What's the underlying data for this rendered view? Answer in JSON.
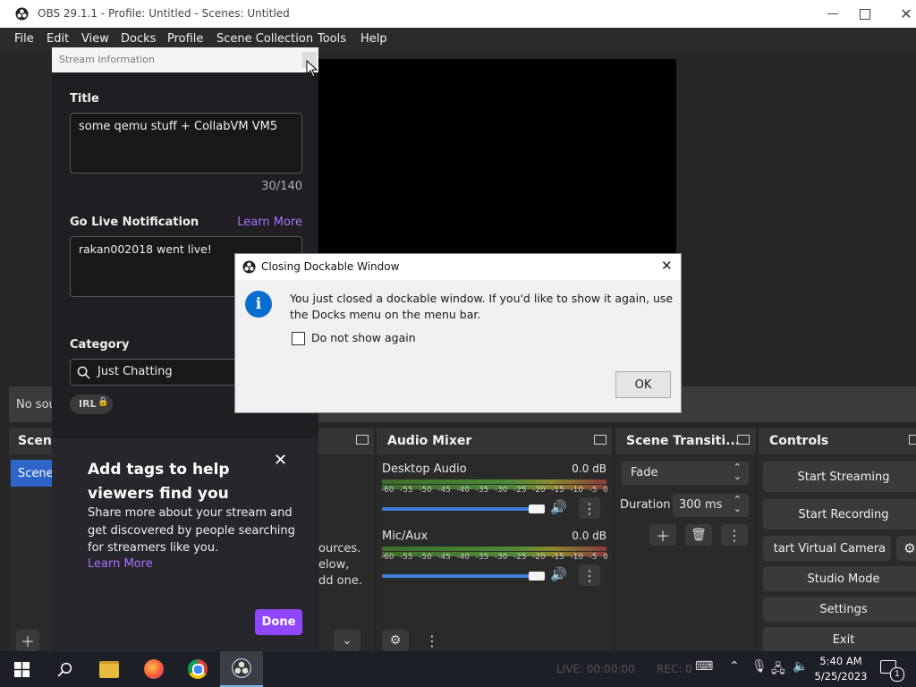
{
  "window": {
    "title": "OBS 29.1.1 - Profile: Untitled - Scenes: Untitled",
    "minimize_icon": "minimize-icon",
    "maximize_icon": "maximize-icon",
    "close_icon": "close-icon"
  },
  "menubar": {
    "items": [
      "File",
      "Edit",
      "View",
      "Docks",
      "Profile",
      "Scene Collection",
      "Tools",
      "Help"
    ]
  },
  "sources_placeholder": "No sou",
  "scenes_dock": {
    "title": "Scene",
    "selected_scene": "Scene"
  },
  "sources_dock": {
    "hint_lines": [
      "ources.",
      "elow,",
      "dd one."
    ]
  },
  "audio_mixer": {
    "title": "Audio Mixer",
    "channels": [
      {
        "name": "Desktop Audio",
        "level": "0.0 dB",
        "volume_fraction": 0.96
      },
      {
        "name": "Mic/Aux",
        "level": "0.0 dB",
        "volume_fraction": 0.96
      }
    ],
    "ticks": [
      "-60",
      "-55",
      "-50",
      "-45",
      "-40",
      "-35",
      "-30",
      "-25",
      "-20",
      "-15",
      "-10",
      "-5",
      "0"
    ]
  },
  "scene_transitions": {
    "title": "Scene Transiti...",
    "transition": "Fade",
    "duration_label": "Duration",
    "duration_value": "300 ms"
  },
  "controls": {
    "title": "Controls",
    "buttons": [
      "Start Streaming",
      "Start Recording",
      "Start Virtual Camera",
      "Studio Mode",
      "Settings",
      "Exit"
    ],
    "virtual_camera_visible": "tart Virtual Camera"
  },
  "stream_info": {
    "header": "Stream Information",
    "title_label": "Title",
    "title_value": "some qemu stuff + CollabVM VM5",
    "title_count": "30/140",
    "notification_label": "Go Live Notification",
    "learn_more": "Learn More",
    "notification_value": "rakan002018 went live!",
    "category_label": "Category",
    "category_value": "Just Chatting",
    "tag": "IRL",
    "popup": {
      "heading": "Add tags to help viewers find you",
      "body": "Share more about your stream and get discovered by people searching for streamers like you.",
      "learn_more": "Learn More",
      "done": "Done"
    }
  },
  "dialog": {
    "title": "Closing Dockable Window",
    "message": "You just closed a dockable window. If you'd like to show it again, use the Docks menu on the menu bar.",
    "checkbox_label": "Do not show again",
    "ok": "OK"
  },
  "statusbar": {
    "live": "LIVE: 00:00:00",
    "rec": "REC: 0"
  },
  "taskbar": {
    "time": "5:40 AM",
    "date": "5/25/2023",
    "notification_count": "1"
  },
  "colors": {
    "accent_purple": "#9147ff",
    "link_purple": "#a970ff",
    "slider_blue": "#3f7fd9",
    "info_blue": "#0a6ed1"
  }
}
